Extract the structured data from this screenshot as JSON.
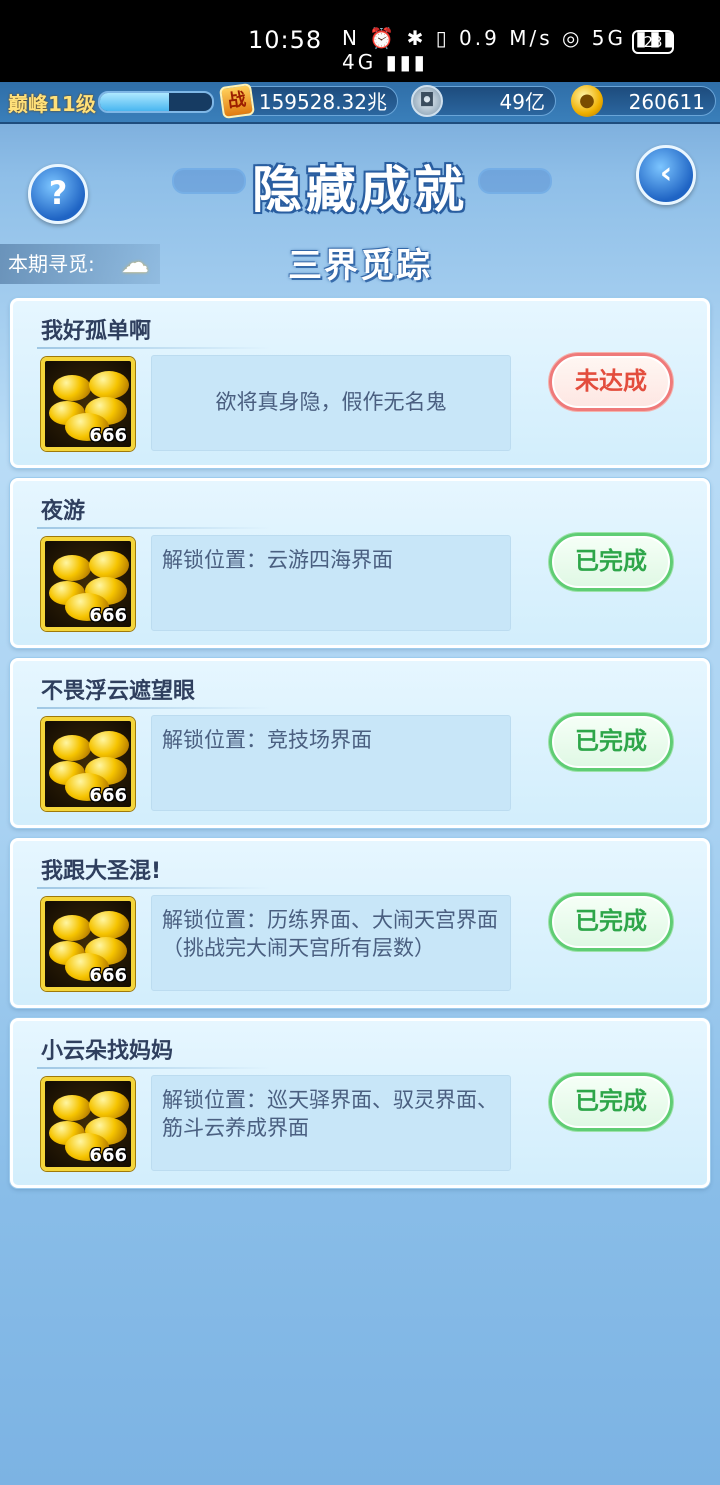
{
  "status_bar": {
    "time": "10:58",
    "icons": "N ⏰ ✱ ▯ 0.9 M/s ◎ 5G ▮▮▮ 4G ▮▮▮",
    "battery": "23"
  },
  "resources": {
    "level": "巅峰11级",
    "level_progress": 0.62,
    "power_icon_text": "战",
    "power": "159528.32兆",
    "silver": "49亿",
    "gold": "260611"
  },
  "header": {
    "help_label": "?",
    "back_label": "‹",
    "title": "隐藏成就",
    "period_label": "本期寻觅:",
    "subtitle": "三界觅踪"
  },
  "achievements": [
    {
      "name": "我好孤单啊",
      "reward_qty": "666",
      "desc": "欲将真身隐，假作无名鬼",
      "status": "未达成"
    },
    {
      "name": "夜游",
      "reward_qty": "666",
      "desc": "解锁位置：云游四海界面",
      "status": "已完成"
    },
    {
      "name": "不畏浮云遮望眼",
      "reward_qty": "666",
      "desc": "解锁位置：竞技场界面",
      "status": "已完成"
    },
    {
      "name": "我跟大圣混!",
      "reward_qty": "666",
      "desc": "解锁位置：历练界面、大闹天宫界面（挑战完大闹天宫所有层数）",
      "status": "已完成"
    },
    {
      "name": "小云朵找妈妈",
      "reward_qty": "666",
      "desc": "解锁位置：巡天驿界面、驭灵界面、筋斗云养成界面",
      "status": "已完成"
    }
  ],
  "colors": {
    "done": "#2ea64a",
    "pending": "#e34d3d",
    "gold_frame": "#f4d53a"
  }
}
